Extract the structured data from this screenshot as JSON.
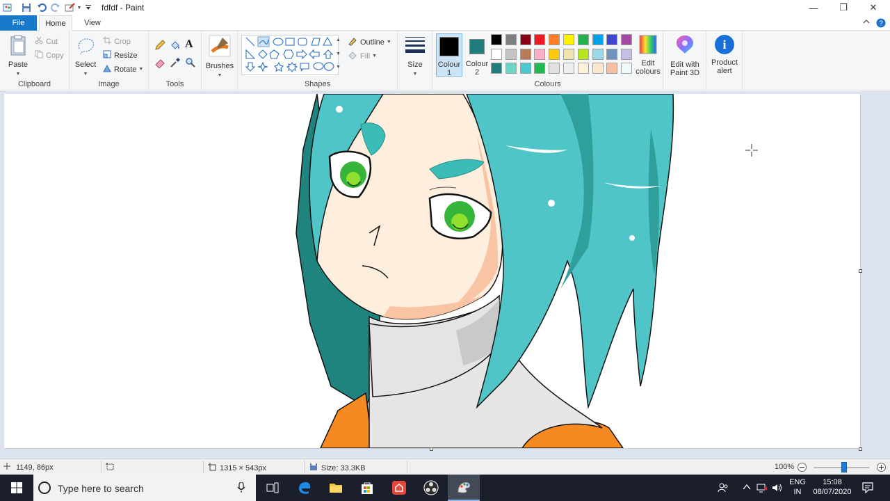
{
  "window": {
    "title": "fdfdf - Paint",
    "minimize_glyph": "—",
    "maximize_glyph": "❐",
    "close_glyph": "✕"
  },
  "tabs": {
    "file": "File",
    "home": "Home",
    "view": "View"
  },
  "clipboard": {
    "paste": "Paste",
    "cut": "Cut",
    "copy": "Copy",
    "label": "Clipboard"
  },
  "image": {
    "select": "Select",
    "crop": "Crop",
    "resize": "Resize",
    "rotate": "Rotate",
    "label": "Image"
  },
  "tools": {
    "label": "Tools",
    "text_glyph": "A"
  },
  "brushes": {
    "label": "Brushes"
  },
  "shapes": {
    "label": "Shapes",
    "outline": "Outline",
    "fill": "Fill"
  },
  "size": {
    "label": "Size"
  },
  "colours": {
    "colour1_l1": "Colour",
    "colour1_l2": "1",
    "colour2_l1": "Colour",
    "colour2_l2": "2",
    "colour1": "#000000",
    "colour2": "#1e7c7a",
    "edit_l1": "Edit",
    "edit_l2": "colours",
    "label": "Colours",
    "palette": [
      [
        "#000000",
        "#7f7f7f",
        "#880015",
        "#ed1c24",
        "#ff7f27",
        "#fff200",
        "#22b14c",
        "#00a2e8",
        "#3f48cc",
        "#a349a4"
      ],
      [
        "#ffffff",
        "#c3c3c3",
        "#b97a57",
        "#ffaec9",
        "#ffc90e",
        "#efe4b0",
        "#b5e61d",
        "#99d9ea",
        "#7092be",
        "#c8bfe7"
      ],
      [
        "#1e7c7a",
        "#6ad5c8",
        "#4cc9d0",
        "#20b850",
        "#e0e0e0",
        "#efefef",
        "#fdf1dc",
        "#fde6cf",
        "#f6bfa0",
        "#f0fafa"
      ]
    ]
  },
  "paint3d": {
    "l1": "Edit with",
    "l2": "Paint 3D"
  },
  "alert": {
    "l1": "Product",
    "l2": "alert",
    "glyph": "i"
  },
  "status": {
    "cursor_pos": "1149, 86px",
    "image_dims": "1315 × 543px",
    "file_size": "Size: 33.3KB",
    "zoom": "100%",
    "zoom_fraction": 0.55
  },
  "taskbar": {
    "search_placeholder": "Type here to search",
    "lang1": "ENG",
    "lang2": "IN",
    "time": "15:08",
    "date": "08/07/2020"
  },
  "icons": [
    "paint-app-icon",
    "save-icon",
    "undo-icon",
    "redo-icon",
    "paint-qa-icon",
    "customize-qa-icon",
    "help-icon",
    "collapse-ribbon-icon",
    "paste-icon",
    "cut-icon",
    "copy-icon",
    "select-icon",
    "crop-icon",
    "resize-icon",
    "rotate-icon",
    "pencil-icon",
    "fill-icon",
    "text-icon",
    "eraser-icon",
    "color-picker-icon",
    "magnifier-icon",
    "brush-icon",
    "size-icon",
    "paint3d-icon",
    "info-icon",
    "cursor-position-icon",
    "selection-size-icon",
    "canvas-size-icon",
    "file-size-icon",
    "zoom-out-icon",
    "zoom-in-icon",
    "windows-start-icon",
    "cortana-icon",
    "microphone-icon",
    "task-view-icon",
    "edge-icon",
    "file-explorer-icon",
    "store-icon",
    "app-icon-red",
    "obs-icon",
    "paint-taskbar-icon",
    "people-icon",
    "chevron-up-icon",
    "network-icon",
    "volume-icon",
    "notification-icon"
  ]
}
